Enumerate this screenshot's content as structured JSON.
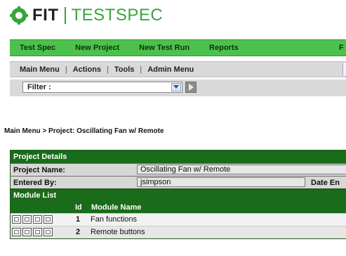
{
  "logo": {
    "brand": "FIT",
    "product": "TESTSPEC"
  },
  "top_nav": {
    "items": [
      "Test Spec",
      "New Project",
      "New Test Run",
      "Reports"
    ],
    "cutoff": "F"
  },
  "menu_bar": {
    "items": [
      "Main Menu",
      "Actions",
      "Tools",
      "Admin Menu"
    ]
  },
  "filter": {
    "label": "Filter :"
  },
  "breadcrumb": "Main Menu > Project: Oscillating Fan w/ Remote",
  "project_details": {
    "header": "Project Details",
    "name_label": "Project Name:",
    "name_value": "Oscillating Fan w/ Remote",
    "entered_by_label": "Entered By:",
    "entered_by_value": "jsimpson",
    "date_label": "Date En"
  },
  "module_list": {
    "header": "Module List",
    "col_id": "Id",
    "col_name": "Module Name",
    "rows": [
      {
        "id": "1",
        "name": "Fan functions"
      },
      {
        "id": "2",
        "name": "Remote buttons"
      }
    ]
  }
}
